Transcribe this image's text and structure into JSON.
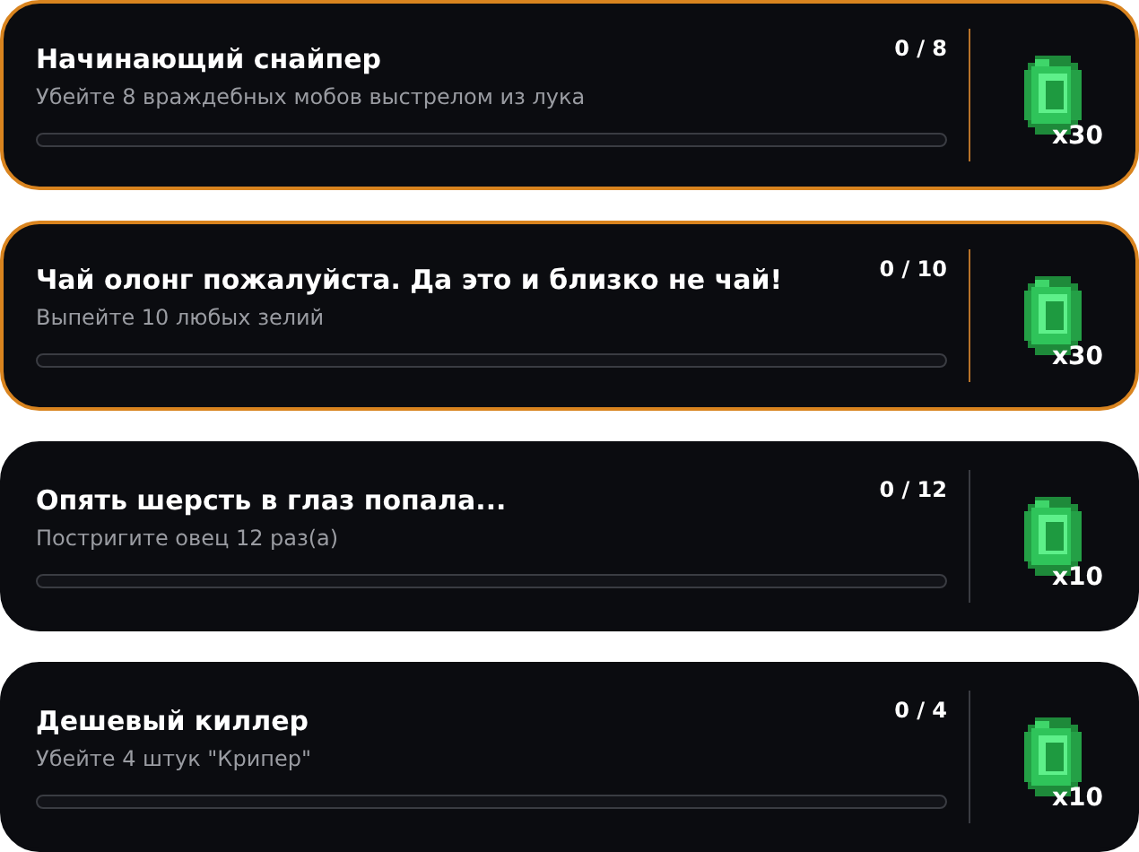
{
  "quests": [
    {
      "title": "Начинающий снайпер",
      "description": "Убейте 8 враждебных мобов выстрелом из лука",
      "progress": "0 / 8",
      "level": 0,
      "reward": "x30",
      "highlighted": true
    },
    {
      "title": "Чай олонг пожалуйста. Да это и близко не чай!",
      "description": "Выпейте 10 любых зелий",
      "progress": "0 / 10",
      "level": 0,
      "reward": "x30",
      "highlighted": true
    },
    {
      "title": "Опять шерсть в глаз попала...",
      "description": "Постригите овец 12 раз(а)",
      "progress": "0 / 12",
      "level": 0,
      "reward": "x10",
      "highlighted": false
    },
    {
      "title": "Дешевый киллер",
      "description": "Убейте 4 штук \"Крипер\"",
      "progress": "0 / 4",
      "level": 0,
      "reward": "x10",
      "highlighted": false
    }
  ]
}
